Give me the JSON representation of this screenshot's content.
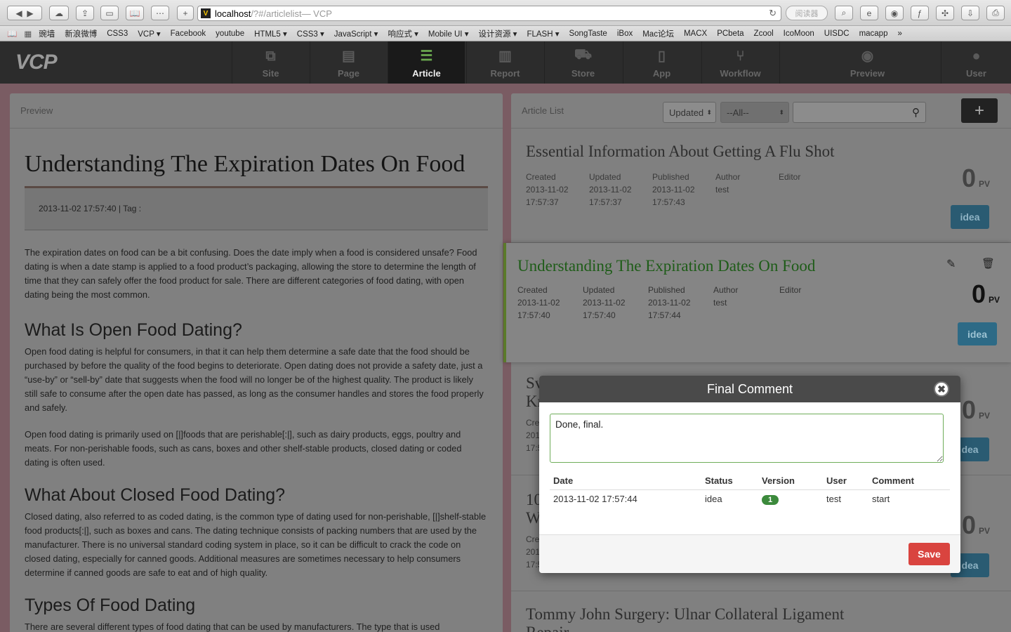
{
  "browser": {
    "url_host": "localhost",
    "url_path": "/?#/articlelist",
    "url_title": " — VCP",
    "reader_label": "阅读器",
    "favicon": "V",
    "bookmarks": [
      "豌墙",
      "新浪微博",
      "CSS3",
      "VCP ▾",
      "Facebook",
      "youtube",
      "HTML5 ▾",
      "CSS3 ▾",
      "JavaScript ▾",
      "响应式 ▾",
      "Mobile UI ▾",
      "设计资源 ▾",
      "FLASH ▾",
      "SongTaste",
      "iBox",
      "Mac论坛",
      "MACX",
      "PCbeta",
      "Zcool",
      "IcoMoon",
      "UISDC",
      "macapp",
      "»"
    ]
  },
  "app": {
    "logo": "VCP",
    "nav": [
      {
        "label": "Site",
        "icon": "⧉"
      },
      {
        "label": "Page",
        "icon": "▤"
      },
      {
        "label": "Article",
        "icon": "☰"
      },
      {
        "label": "Report",
        "icon": "▥"
      },
      {
        "label": "Store",
        "icon": "⛟"
      },
      {
        "label": "App",
        "icon": "▯"
      },
      {
        "label": "Workflow",
        "icon": "⑂"
      },
      {
        "label": "Preview",
        "icon": "◉"
      },
      {
        "label": "User",
        "icon": "●"
      }
    ]
  },
  "preview": {
    "header": "Preview",
    "title": "Understanding The Expiration Dates On Food",
    "meta": "2013-11-02 17:57:40 | Tag :",
    "intro": "The expiration dates on food can be a bit confusing. Does the date imply when a food is considered unsafe? Food dating is when a date stamp is applied to a food product’s packaging, allowing the store to determine the length of time that they can safely offer the food product for sale. There are different categories of food dating, with open dating being the most common.",
    "h_open": "What Is Open Food Dating?",
    "p_open1": "Open food dating is helpful for consumers, in that it can help them determine a safe date that the food should be purchased by before the quality of the food begins to deteriorate. Open dating does not provide a safety date, just a “use-by” or “sell-by” date that suggests when the food will no longer be of the highest quality. The product is likely still safe to consume after the open date has passed, as long as the consumer handles and stores the food properly and safely.",
    "p_open2": "Open food dating is primarily used on [|]foods that are perishable[:|], such as dairy products, eggs, poultry and meats. For non-perishable foods, such as cans, boxes and other shelf-stable products, closed dating or coded dating is often used.",
    "h_closed": "What About Closed Food Dating?",
    "p_closed": "Closed dating, also referred to as coded dating, is the common type of dating used for non-perishable, [|]shelf-stable food products[:|], such as boxes and cans. The dating technique consists of packing numbers that are used by the manufacturer. There is no universal standard coding system in place, so it can be difficult to crack the code on closed dating, especially for canned goods. Additional measures are sometimes necessary to help consumers determine if canned goods are safe to eat and of high quality.",
    "h_types": "Types Of Food Dating",
    "p_types": "There are several different types of food dating that can be used by manufacturers. The type that is used"
  },
  "list": {
    "header": "Article List",
    "sort_value": "Updated",
    "filter_value": "--All--",
    "search_placeholder": "",
    "add_label": "+",
    "col_labels": [
      "Created",
      "Updated",
      "Published",
      "Author",
      "Editor"
    ],
    "items": [
      {
        "title": "Essential Information About Getting A Flu Shot",
        "created": "2013-11-02 17:57:37",
        "updated": "2013-11-02 17:57:37",
        "published": "2013-11-02 17:57:43",
        "author": "test",
        "pv": "0",
        "pv_unit": "PV",
        "status": "idea"
      },
      {
        "title": "Understanding The Expiration Dates On Food",
        "created": "2013-11-02 17:57:40",
        "updated": "2013-11-02 17:57:40",
        "published": "2013-11-02 17:57:44",
        "author": "test",
        "pv": "0",
        "pv_unit": "PV",
        "status": "idea"
      },
      {
        "title_part": "Sv",
        "title_part2": "Kr",
        "created_part": "Cre",
        "pv": "0",
        "pv_unit": "PV",
        "status": "dea",
        "date_part": "201",
        "time_part": "17:5"
      },
      {
        "title_part": "10",
        "title_part2": "W",
        "created_part": "Cre",
        "pv": "0",
        "pv_unit": "PV",
        "status": "dea",
        "date_part": "201",
        "time_part": "17:5"
      },
      {
        "title": "Tommy John Surgery: Ulnar Collateral Ligament Repair"
      }
    ]
  },
  "modal": {
    "title": "Final Comment",
    "comment_value": "Done, final.",
    "columns": [
      "Date",
      "Status",
      "Version",
      "User",
      "Comment"
    ],
    "rows": [
      {
        "date": "2013-11-02 17:57:44",
        "status": "idea",
        "version": "1",
        "user": "test",
        "comment": "start"
      }
    ],
    "save_label": "Save",
    "close_label": "✖"
  }
}
